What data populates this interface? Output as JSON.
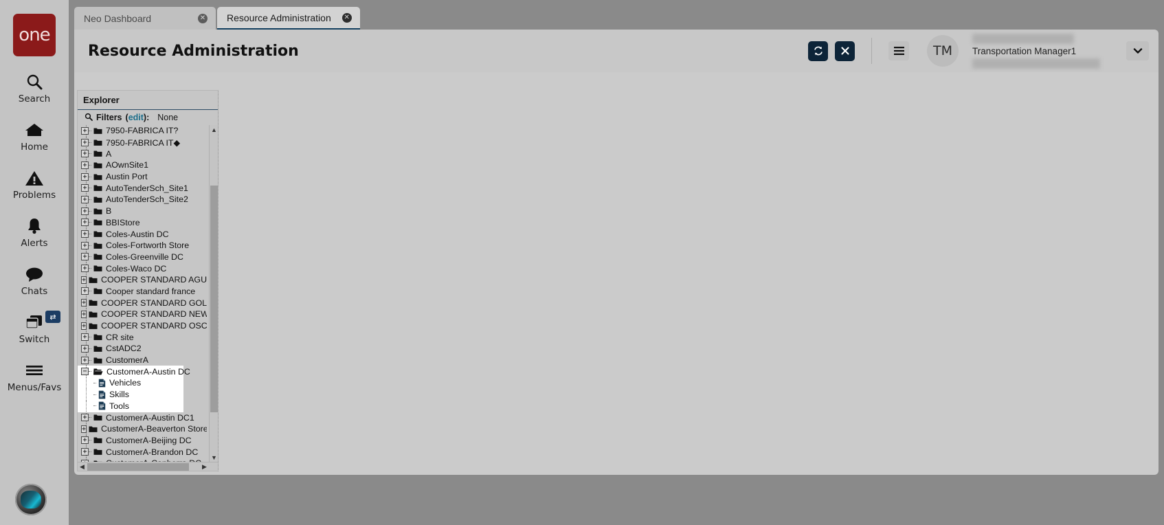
{
  "brand": {
    "logo_text": "one"
  },
  "rail": {
    "items": [
      {
        "label": "Search",
        "icon": "search-icon"
      },
      {
        "label": "Home",
        "icon": "home-icon"
      },
      {
        "label": "Problems",
        "icon": "warning-triangle-icon"
      },
      {
        "label": "Alerts",
        "icon": "bell-icon"
      },
      {
        "label": "Chats",
        "icon": "chat-bubble-icon"
      },
      {
        "label": "Switch",
        "icon": "windows-stack-icon",
        "badge_icon": "swap-arrows-icon"
      },
      {
        "label": "Menus/Favs",
        "icon": "hamburger-icon"
      }
    ],
    "assistant_icon": "assistant-orb-icon"
  },
  "tabs": [
    {
      "label": "Neo Dashboard",
      "active": false,
      "close_icon": "close-circle-icon"
    },
    {
      "label": "Resource Administration",
      "active": true,
      "close_icon": "close-circle-icon"
    }
  ],
  "header": {
    "title": "Resource Administration",
    "refresh_icon": "refresh-icon",
    "close_icon": "close-x-icon",
    "menu_icon": "hamburger-menu-icon",
    "avatar_initials": "TM",
    "user_name": "Transportation Manager1",
    "dropdown_icon": "chevron-down-icon"
  },
  "explorer": {
    "title": "Explorer",
    "filters": {
      "icon": "search-icon",
      "label": "Filters",
      "edit_label": "edit",
      "value": "None"
    },
    "tree": [
      {
        "label": "7950-FABRICA IT?",
        "type": "folder",
        "state": "collapsed",
        "depth": 0
      },
      {
        "label": "7950-FABRICA IT◆",
        "type": "folder",
        "state": "collapsed",
        "depth": 0
      },
      {
        "label": "A",
        "type": "folder",
        "state": "collapsed",
        "depth": 0
      },
      {
        "label": "AOwnSite1",
        "type": "folder",
        "state": "collapsed",
        "depth": 0
      },
      {
        "label": "Austin Port",
        "type": "folder",
        "state": "collapsed",
        "depth": 0
      },
      {
        "label": "AutoTenderSch_Site1",
        "type": "folder",
        "state": "collapsed",
        "depth": 0
      },
      {
        "label": "AutoTenderSch_Site2",
        "type": "folder",
        "state": "collapsed",
        "depth": 0
      },
      {
        "label": "B",
        "type": "folder",
        "state": "collapsed",
        "depth": 0
      },
      {
        "label": "BBIStore",
        "type": "folder",
        "state": "collapsed",
        "depth": 0
      },
      {
        "label": "Coles-Austin DC",
        "type": "folder",
        "state": "collapsed",
        "depth": 0
      },
      {
        "label": "Coles-Fortworth Store",
        "type": "folder",
        "state": "collapsed",
        "depth": 0
      },
      {
        "label": "Coles-Greenville DC",
        "type": "folder",
        "state": "collapsed",
        "depth": 0
      },
      {
        "label": "Coles-Waco DC",
        "type": "folder",
        "state": "collapsed",
        "depth": 0
      },
      {
        "label": "COOPER STANDARD AGUAS SEAL",
        "type": "folder",
        "state": "collapsed",
        "depth": 0
      },
      {
        "label": "Cooper standard france",
        "type": "folder",
        "state": "collapsed",
        "depth": 0
      },
      {
        "label": "COOPER STANDARD GOLDSBORO",
        "type": "folder",
        "state": "collapsed",
        "depth": 0
      },
      {
        "label": "COOPER STANDARD NEW LEXINGT",
        "type": "folder",
        "state": "collapsed",
        "depth": 0
      },
      {
        "label": "COOPER STANDARD OSCODA",
        "type": "folder",
        "state": "collapsed",
        "depth": 0
      },
      {
        "label": "CR site",
        "type": "folder",
        "state": "collapsed",
        "depth": 0
      },
      {
        "label": "CstADC2",
        "type": "folder",
        "state": "collapsed",
        "depth": 0
      },
      {
        "label": "CustomerA",
        "type": "folder",
        "state": "collapsed",
        "depth": 0
      },
      {
        "label": "CustomerA-Austin DC",
        "type": "folder",
        "state": "expanded",
        "depth": 0,
        "highlighted": true
      },
      {
        "label": "Vehicles",
        "type": "document",
        "depth": 1,
        "highlighted": true
      },
      {
        "label": "Skills",
        "type": "document",
        "depth": 1,
        "highlighted": true
      },
      {
        "label": "Tools",
        "type": "document",
        "depth": 1,
        "highlighted": true
      },
      {
        "label": "CustomerA-Austin DC1",
        "type": "folder",
        "state": "collapsed",
        "depth": 0
      },
      {
        "label": "CustomerA-Beaverton Store",
        "type": "folder",
        "state": "collapsed",
        "depth": 0
      },
      {
        "label": "CustomerA-Beijing DC",
        "type": "folder",
        "state": "collapsed",
        "depth": 0
      },
      {
        "label": "CustomerA-Brandon DC",
        "type": "folder",
        "state": "collapsed",
        "depth": 0
      },
      {
        "label": "CustomerA-Canberra DC",
        "type": "folder",
        "state": "collapsed",
        "depth": 0
      }
    ],
    "scrollbar": {
      "up_arrow_icon": "caret-up-icon",
      "down_arrow_icon": "caret-down-icon",
      "left_arrow_icon": "caret-left-icon",
      "right_arrow_icon": "caret-right-icon"
    }
  },
  "colors": {
    "brand_red": "#8b1a1a",
    "accent_navy": "#0d2438",
    "tab_active_underline": "#14405f",
    "link_teal": "#1d6f8b",
    "app_background": "#8a8a8a",
    "panel_gray": "#c6c6c6"
  }
}
